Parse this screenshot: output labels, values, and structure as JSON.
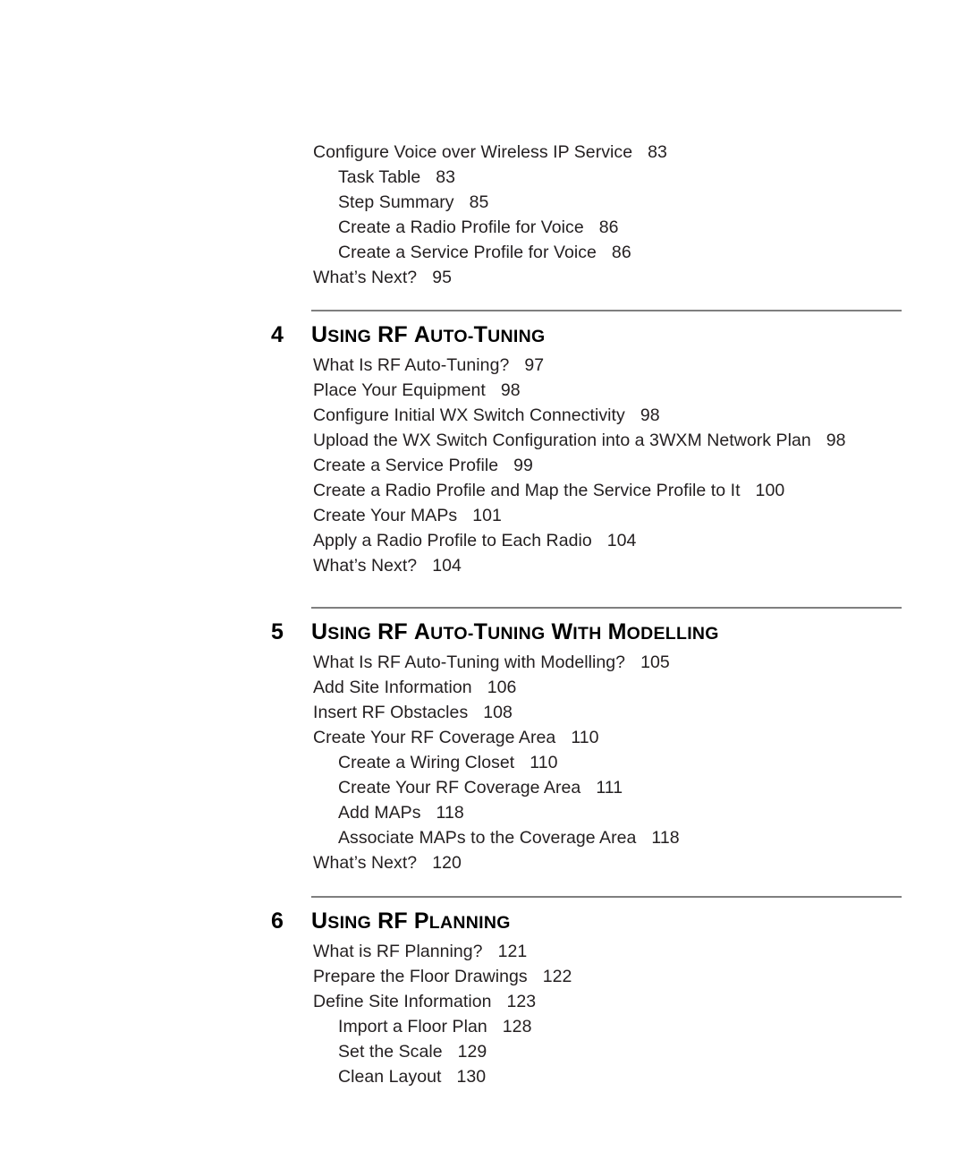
{
  "document": {
    "type": "table-of-contents",
    "text_color": "#231f20",
    "rule_color": "#7f7f7f",
    "background": "#ffffff"
  },
  "top_section": {
    "entries": [
      {
        "level": 1,
        "title": "Configure Voice over Wireless IP Service",
        "page": "83"
      },
      {
        "level": 2,
        "title": "Task Table",
        "page": "83"
      },
      {
        "level": 2,
        "title": "Step Summary",
        "page": "85"
      },
      {
        "level": 2,
        "title": "Create a Radio Profile for Voice",
        "page": "86"
      },
      {
        "level": 2,
        "title": "Create a Service Profile for Voice",
        "page": "86"
      },
      {
        "level": 1,
        "title": "What’s Next?",
        "page": "95"
      }
    ]
  },
  "chapters": [
    {
      "number": "4",
      "title": "Using RF Auto-Tuning",
      "title_words": [
        {
          "cap": "U",
          "sc": "SING"
        },
        {
          "cap": "RF",
          "sc": ""
        },
        {
          "cap": "A",
          "sc": "UTO-T"
        },
        {
          "cap": "",
          "sc": "UNING"
        }
      ],
      "entries": [
        {
          "level": 1,
          "title": "What Is RF Auto-Tuning?",
          "page": "97"
        },
        {
          "level": 1,
          "title": "Place Your Equipment",
          "page": "98"
        },
        {
          "level": 1,
          "title": "Configure Initial WX Switch Connectivity",
          "page": "98"
        },
        {
          "level": 1,
          "title": "Upload the WX Switch Configuration into a 3WXM Network Plan",
          "page": "98"
        },
        {
          "level": 1,
          "title": "Create a Service Profile",
          "page": "99"
        },
        {
          "level": 1,
          "title": "Create a Radio Profile and Map the Service Profile to It",
          "page": "100"
        },
        {
          "level": 1,
          "title": "Create Your MAPs",
          "page": "101"
        },
        {
          "level": 1,
          "title": "Apply a Radio Profile to Each Radio",
          "page": "104"
        },
        {
          "level": 1,
          "title": "What’s Next?",
          "page": "104"
        }
      ]
    },
    {
      "number": "5",
      "title": "Using RF Auto-Tuning with Modelling",
      "entries": [
        {
          "level": 1,
          "title": "What Is RF Auto-Tuning with Modelling?",
          "page": "105"
        },
        {
          "level": 1,
          "title": "Add Site Information",
          "page": "106"
        },
        {
          "level": 1,
          "title": "Insert RF Obstacles",
          "page": "108"
        },
        {
          "level": 1,
          "title": "Create Your RF Coverage Area",
          "page": "110"
        },
        {
          "level": 2,
          "title": "Create a Wiring Closet",
          "page": "110"
        },
        {
          "level": 2,
          "title": "Create Your RF Coverage Area",
          "page": "111"
        },
        {
          "level": 2,
          "title": "Add MAPs",
          "page": "118"
        },
        {
          "level": 2,
          "title": "Associate MAPs to the Coverage Area",
          "page": "118"
        },
        {
          "level": 1,
          "title": "What’s Next?",
          "page": "120"
        }
      ]
    },
    {
      "number": "6",
      "title": "Using RF Planning",
      "entries": [
        {
          "level": 1,
          "title": "What is RF Planning?",
          "page": "121"
        },
        {
          "level": 1,
          "title": "Prepare the Floor Drawings",
          "page": "122"
        },
        {
          "level": 1,
          "title": "Define Site Information",
          "page": "123"
        },
        {
          "level": 2,
          "title": "Import a Floor Plan",
          "page": "128"
        },
        {
          "level": 2,
          "title": "Set the Scale",
          "page": "129"
        },
        {
          "level": 2,
          "title": "Clean Layout",
          "page": "130"
        }
      ]
    }
  ]
}
